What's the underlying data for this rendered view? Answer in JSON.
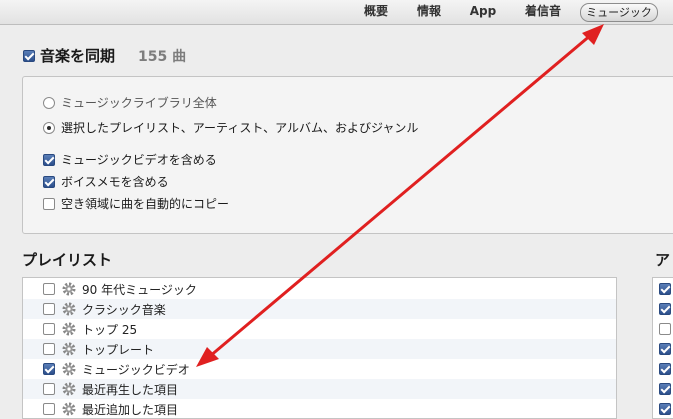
{
  "tabs": [
    {
      "label": "概要",
      "active": false
    },
    {
      "label": "情報",
      "active": false
    },
    {
      "label": "App",
      "active": false
    },
    {
      "label": "着信音",
      "active": false
    },
    {
      "label": "ミュージック",
      "active": true
    }
  ],
  "sync": {
    "title": "音楽を同期",
    "count": "155 曲",
    "checked": true
  },
  "options": {
    "radios": [
      {
        "label": "ミュージックライブラリ全体",
        "selected": false
      },
      {
        "label": "選択したプレイリスト、アーティスト、アルバム、およびジャンル",
        "selected": true
      }
    ],
    "checkboxes": [
      {
        "label": "ミュージックビデオを含める",
        "checked": true
      },
      {
        "label": "ボイスメモを含める",
        "checked": true
      },
      {
        "label": "空き領域に曲を自動的にコピー",
        "checked": false
      }
    ]
  },
  "playlists": {
    "title": "プレイリスト",
    "items": [
      {
        "label": "90 年代ミュージック",
        "checked": false
      },
      {
        "label": "クラシック音楽",
        "checked": false
      },
      {
        "label": "トップ 25",
        "checked": false
      },
      {
        "label": "トップレート",
        "checked": false
      },
      {
        "label": "ミュージックビデオ",
        "checked": true
      },
      {
        "label": "最近再生した項目",
        "checked": false
      },
      {
        "label": "最近追加した項目",
        "checked": false
      }
    ]
  },
  "artists": {
    "title": "ア",
    "checked": [
      true,
      true,
      false,
      true,
      true,
      true,
      true
    ]
  },
  "colors": {
    "arrow": "#e02020",
    "checkbox_on": "#2c4f8c"
  },
  "icons": {
    "playlist": "gear-icon"
  }
}
